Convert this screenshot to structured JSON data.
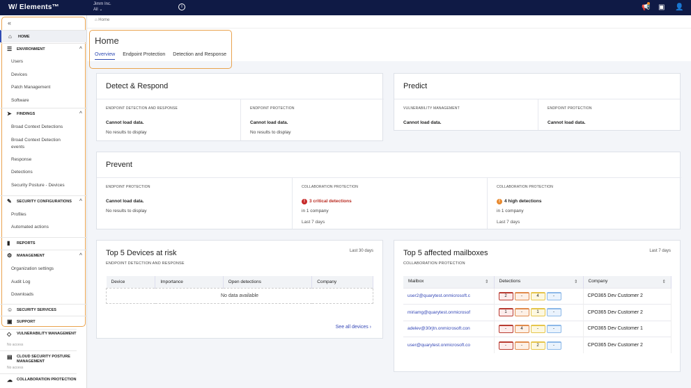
{
  "topbar": {
    "logo": "W/ Elements™",
    "org_name": "Jimm Inc.",
    "org_scope": "All"
  },
  "sidebar": {
    "collapse": "«",
    "home": "HOME",
    "environment": {
      "label": "ENVIRONMENT",
      "items": [
        "Users",
        "Devices",
        "Patch Management",
        "Software"
      ]
    },
    "findings": {
      "label": "FINDINGS",
      "items": [
        "Broad Context Detections",
        "Broad Context Detection events",
        "Response",
        "Detections",
        "Security Posture - Devices"
      ]
    },
    "security_configurations": {
      "label": "SECURITY CONFIGURATIONS",
      "items": [
        "Profiles",
        "Automated actions"
      ]
    },
    "reports": "REPORTS",
    "management": {
      "label": "MANAGEMENT",
      "items": [
        "Organization settings",
        "Audit Log",
        "Downloads"
      ]
    },
    "security_services": "SECURITY SERVICES",
    "support": "SUPPORT",
    "locked": [
      {
        "label": "VULNERABILITY MANAGEMENT",
        "status": "No access"
      },
      {
        "label": "CLOUD SECURITY POSTURE MANAGEMENT",
        "status": "No access"
      },
      {
        "label": "COLLABORATION PROTECTION"
      }
    ]
  },
  "breadcrumb": "Home",
  "page": {
    "title": "Home",
    "tabs": [
      "Overview",
      "Endpoint Protection",
      "Detection and Response"
    ]
  },
  "detect": {
    "title": "Detect & Respond",
    "sections": [
      {
        "label": "ENDPOINT DETECTION AND RESPONSE",
        "v1": "Cannot load data.",
        "v2": "No results to display"
      },
      {
        "label": "ENDPOINT PROTECTION",
        "v1": "Cannot load data.",
        "v2": "No results to display"
      }
    ]
  },
  "predict": {
    "title": "Predict",
    "sections": [
      {
        "label": "VULNERABILITY MANAGEMENT",
        "v1": "Cannot load data."
      },
      {
        "label": "ENDPOINT PROTECTION",
        "v1": "Cannot load data."
      }
    ]
  },
  "prevent": {
    "title": "Prevent",
    "sections": [
      {
        "label": "ENDPOINT PROTECTION",
        "v1": "Cannot load data.",
        "v2": "No results to display"
      },
      {
        "label": "COLLABORATION PROTECTION",
        "v1": "3 critical detections",
        "v2": "in 1 company",
        "v3": "Last 7 days"
      },
      {
        "label": "COLLABORATION PROTECTION",
        "v1": "4 high detections",
        "v2": "in 1 company",
        "v3": "Last 7 days"
      }
    ]
  },
  "devices": {
    "title": "Top 5 Devices at risk",
    "subtitle": "ENDPOINT DETECTION AND RESPONSE",
    "period": "Last 30 days",
    "columns": [
      "Device",
      "Importance",
      "Open detections",
      "Company"
    ],
    "empty": "No data available",
    "link": "See all devices ›"
  },
  "mailboxes": {
    "title": "Top 5 affected mailboxes",
    "subtitle": "COLLABORATION PROTECTION",
    "period": "Last 7 days",
    "columns": [
      "Mailbox",
      "Detections",
      "Company"
    ],
    "rows": [
      {
        "mailbox": "user2@quarytest.onmicrosoft.c",
        "d": [
          "2",
          "-",
          "4",
          "-"
        ],
        "company": "CPO365 Dev Customer 2"
      },
      {
        "mailbox": "miriamg@quarytest.onmicrosof",
        "d": [
          "1",
          "-",
          "1",
          "-"
        ],
        "company": "CPO365 Dev Customer 2"
      },
      {
        "mailbox": "adelev@30rjtn.onmicrosoft.con",
        "d": [
          "-",
          "4",
          "-",
          "-"
        ],
        "company": "CPO365 Dev Customer 1"
      },
      {
        "mailbox": "user@quarytest.onmicrosoft.co",
        "d": [
          "-",
          "-",
          "2",
          "-"
        ],
        "company": "CPO365 Dev Customer 2"
      }
    ]
  },
  "colors": {
    "nav": "#0f1a45",
    "accent": "#2f4bb3",
    "highlight": "#e9a24d",
    "critical": "#c62828",
    "high": "#e8892e"
  }
}
